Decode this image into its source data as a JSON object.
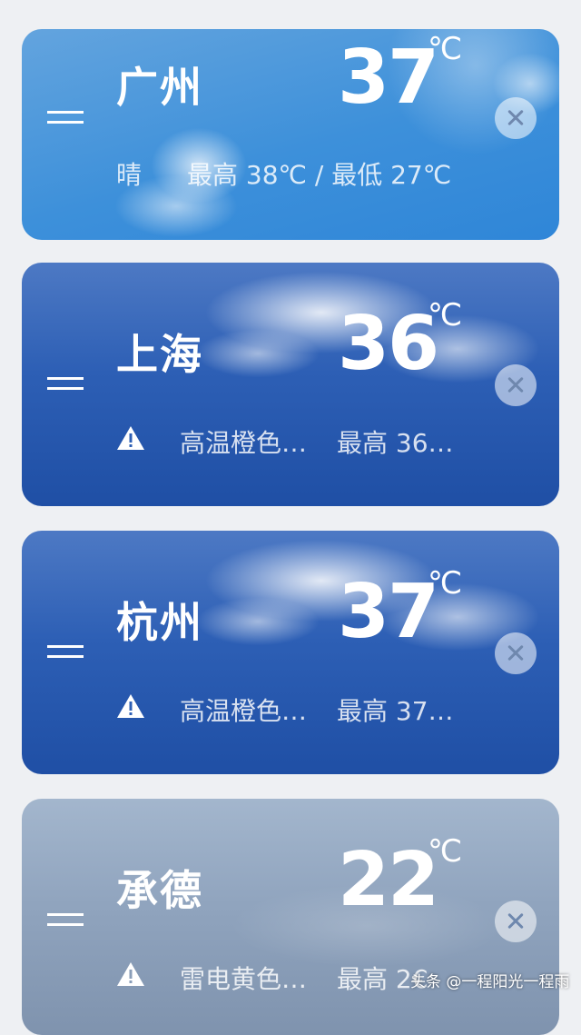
{
  "cities": [
    {
      "name": "广州",
      "temp": "37",
      "unit": "℃",
      "condition": "晴",
      "range": "最高 38℃ / 最低 27℃"
    },
    {
      "name": "上海",
      "temp": "36",
      "unit": "℃",
      "alert": "高温橙色…",
      "high": "最高 36…"
    },
    {
      "name": "杭州",
      "temp": "37",
      "unit": "℃",
      "alert": "高温橙色…",
      "high": "最高 37…"
    },
    {
      "name": "承德",
      "temp": "22",
      "unit": "℃",
      "alert": "雷电黄色…",
      "high": "最高 2€"
    }
  ],
  "icons": {
    "drag": "drag-handle-icon",
    "remove": "close-icon",
    "warning": "warning-icon"
  },
  "colors": {
    "sunny": "#3d90da",
    "cloudy": "#2d5fb5",
    "overcast": "#90a4be",
    "page_bg": "#eef0f3"
  },
  "watermark": "头条 @一程阳光一程雨"
}
